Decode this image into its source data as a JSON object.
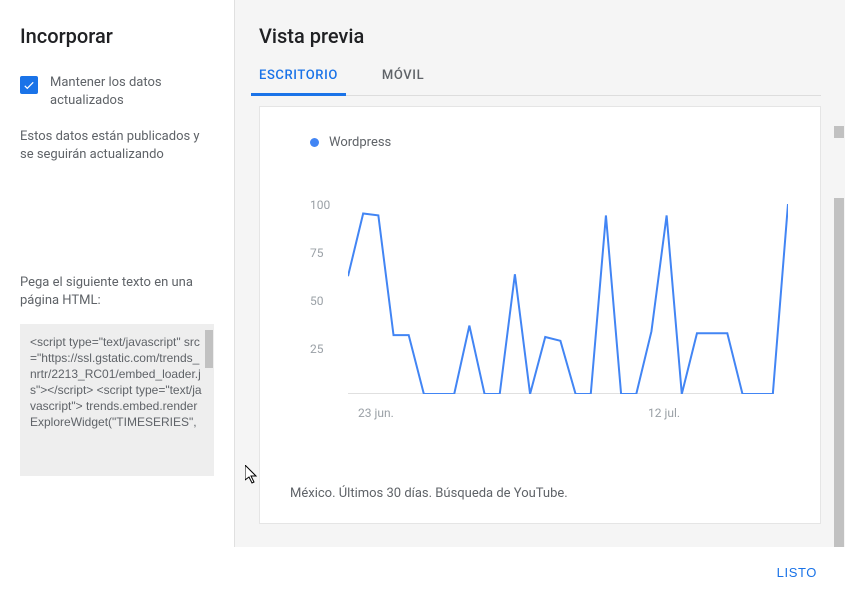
{
  "sidebar": {
    "title": "Incorporar",
    "checkbox_label": "Mantener los datos actualizados",
    "info_text": "Estos datos están publicados y se seguirán actualizando",
    "paste_label": "Pega el siguiente texto en una página HTML:",
    "code": "<script type=\"text/javascript\" src=\"https://ssl.gstatic.com/trends_nrtr/2213_RC01/embed_loader.js\"></script> <script type=\"text/javascript\"> trends.embed.renderExploreWidget(\"TIMESERIES\","
  },
  "preview": {
    "title": "Vista previa",
    "tabs": [
      "ESCRITORIO",
      "MÓVIL"
    ],
    "footer_text": "México. Últimos 30 días. Búsqueda de YouTube."
  },
  "buttons": {
    "ready": "LISTO"
  },
  "chart_data": {
    "type": "line",
    "title": "",
    "xlabel": "",
    "ylabel": "",
    "ylim": [
      0,
      100
    ],
    "yticks": [
      "100",
      "75",
      "50",
      "25"
    ],
    "xticks": [
      {
        "label": "23 jun.",
        "x_index": 2
      },
      {
        "label": "12 jul.",
        "x_index": 21
      }
    ],
    "series": [
      {
        "name": "Wordpress",
        "color": "#4285f4",
        "values": [
          62,
          95,
          94,
          31,
          31,
          0,
          0,
          0,
          36,
          0,
          0,
          63,
          0,
          30,
          28,
          0,
          0,
          94,
          0,
          0,
          33,
          94,
          0,
          32,
          32,
          32,
          0,
          0,
          0,
          100
        ]
      }
    ]
  }
}
